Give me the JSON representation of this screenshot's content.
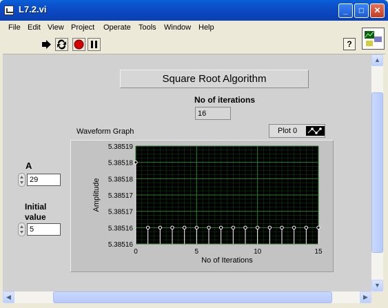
{
  "window": {
    "title": "L7.2.vi"
  },
  "title_buttons": {
    "minimize": "_",
    "maximize": "□",
    "close": "✕"
  },
  "menu": [
    "File",
    "Edit",
    "View",
    "Project",
    "Operate",
    "Tools",
    "Window",
    "Help"
  ],
  "toolbar": {
    "help": "?"
  },
  "panel": {
    "title": "Square Root Algorithm",
    "iterations_label": "No of iterations",
    "iterations_value": "16",
    "a_label": "A",
    "a_value": "29",
    "initial_label_1": "Initial",
    "initial_label_2": "value",
    "initial_value": "5",
    "graph_label": "Waveform Graph",
    "legend_label": "Plot 0"
  },
  "chart_data": {
    "type": "scatter",
    "xlabel": "No of Iterations",
    "ylabel": "Amplitude",
    "xlim": [
      0,
      15
    ],
    "ylim": [
      5.38516,
      5.38519
    ],
    "x_ticks": [
      "0",
      "5",
      "10",
      "15"
    ],
    "y_ticks": [
      "5.38519",
      "5.38518",
      "5.38518",
      "5.38517",
      "5.38517",
      "5.38516",
      "5.38516"
    ],
    "grid": true,
    "series": [
      {
        "name": "Plot 0",
        "x": [
          0,
          1,
          2,
          3,
          4,
          5,
          6,
          7,
          8,
          9,
          10,
          11,
          12,
          13,
          14,
          15
        ],
        "values": [
          5.385185,
          5.385165,
          5.385165,
          5.385165,
          5.385165,
          5.385165,
          5.385165,
          5.385165,
          5.385165,
          5.385165,
          5.385165,
          5.385165,
          5.385165,
          5.385165,
          5.385165,
          5.385165
        ]
      }
    ],
    "colors": {
      "background": "#000000",
      "grid": "#2a7d2a",
      "points": "#ffffff"
    }
  }
}
